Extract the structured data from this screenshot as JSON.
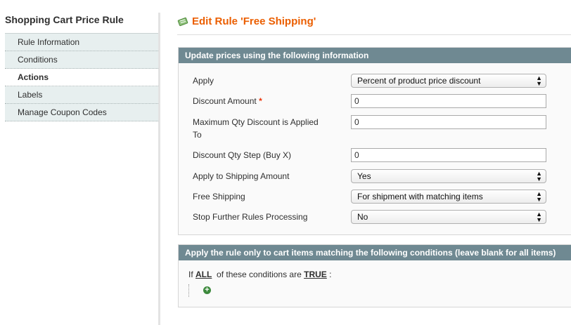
{
  "sidebar": {
    "title": "Shopping Cart Price Rule",
    "tabs": [
      {
        "label": "Rule Information"
      },
      {
        "label": "Conditions"
      },
      {
        "label": "Actions",
        "active": true
      },
      {
        "label": "Labels"
      },
      {
        "label": "Manage Coupon Codes"
      }
    ]
  },
  "page": {
    "title": "Edit Rule 'Free Shipping'",
    "icon": "edit-rule-icon"
  },
  "actions_section": {
    "heading": "Update prices using the following information",
    "fields": {
      "apply": {
        "label": "Apply",
        "value": "Percent of product price discount"
      },
      "discount_amount": {
        "label": "Discount Amount",
        "required_mark": "*",
        "value": "0"
      },
      "max_qty": {
        "label": "Maximum Qty Discount is Applied To",
        "value": "0"
      },
      "qty_step": {
        "label": "Discount Qty Step (Buy X)",
        "value": "0"
      },
      "apply_shipping": {
        "label": "Apply to Shipping Amount",
        "value": "Yes"
      },
      "free_shipping": {
        "label": "Free Shipping",
        "value": "For shipment with matching items"
      },
      "stop_rules": {
        "label": "Stop Further Rules Processing",
        "value": "No"
      }
    }
  },
  "conditions_section": {
    "heading": "Apply the rule only to cart items matching the following conditions (leave blank for all items)",
    "prefix": "If",
    "aggregator": "ALL",
    "middle": "of these conditions are",
    "value": "TRUE",
    "suffix": ":"
  },
  "colors": {
    "accent": "#eb5e00",
    "section_header": "#6f8992",
    "tab_bg": "#e7efef",
    "add_icon": "#3d8a3d"
  }
}
